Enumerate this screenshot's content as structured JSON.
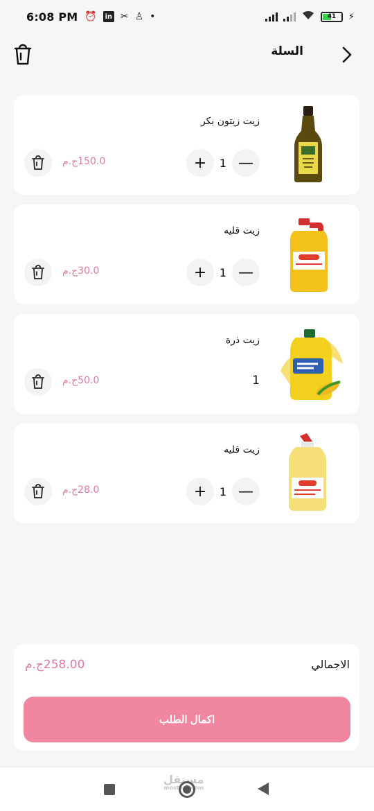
{
  "status_bar": {
    "time": "6:08 PM",
    "battery": "41",
    "linkedin": "in"
  },
  "header": {
    "title": "السلة"
  },
  "cart_items": [
    {
      "name": "زيت زيتون بكر",
      "quantity": "1",
      "price": "150.0ج.م",
      "has_stepper": true
    },
    {
      "name": "زيت قليه",
      "quantity": "1",
      "price": "30.0ج.م",
      "has_stepper": true
    },
    {
      "name": "زيت ذرة",
      "quantity": "1",
      "price": "50.0ج.م",
      "has_stepper": false
    },
    {
      "name": "زيت قليه",
      "quantity": "1",
      "price": "28.0ج.م",
      "has_stepper": true
    }
  ],
  "stepper": {
    "minus": "—",
    "plus": "+"
  },
  "summary": {
    "total_label": "الاجمالي",
    "total_value": "258.00ج.م",
    "checkout_label": "اكمال الطلب"
  },
  "watermark": {
    "text": "مستقل",
    "sub": "mostaql.com"
  },
  "colors": {
    "accent": "#f0869f",
    "price": "#e07aa0",
    "background": "#f6f6f8"
  }
}
